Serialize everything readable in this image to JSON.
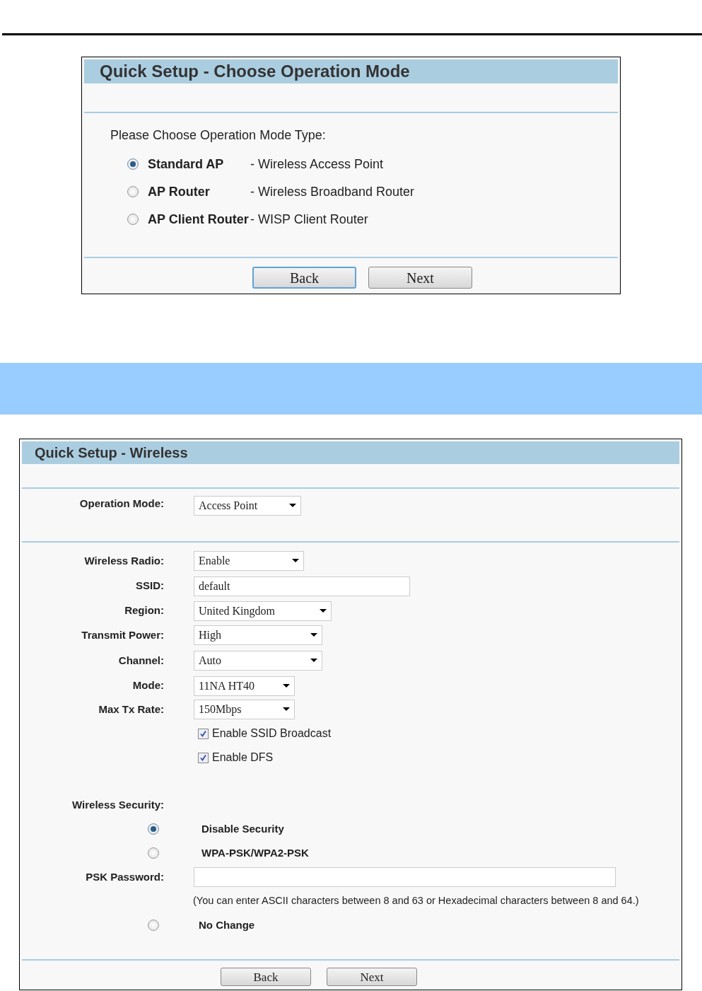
{
  "mode_panel": {
    "title": "Quick Setup - Choose Operation Mode",
    "prompt": "Please Choose Operation Mode Type:",
    "options": [
      {
        "name": "Standard AP",
        "description": "- Wireless Access Point",
        "selected": true
      },
      {
        "name": "AP Router",
        "description": "- Wireless Broadband Router",
        "selected": false
      },
      {
        "name": "AP Client Router",
        "description": "- WISP Client Router",
        "selected": false
      }
    ],
    "buttons": [
      {
        "label": "Back",
        "focused": true
      },
      {
        "label": "Next",
        "focused": false
      }
    ]
  },
  "wireless_panel": {
    "title": "Quick Setup - Wireless",
    "operation_mode": {
      "label": "Operation Mode:",
      "value": "Access Point"
    },
    "fields": [
      {
        "kind": "select",
        "label": "Wireless Radio:",
        "value": "Enable"
      },
      {
        "kind": "text",
        "label": "SSID:",
        "value": "default"
      },
      {
        "kind": "select",
        "label": "Region:",
        "value": "United Kingdom"
      },
      {
        "kind": "select",
        "label": "Transmit Power:",
        "value": "High"
      },
      {
        "kind": "select",
        "label": "Channel:",
        "value": "Auto"
      },
      {
        "kind": "select",
        "label": "Mode:",
        "value": "11NA HT40"
      },
      {
        "kind": "select",
        "label": "Max Tx Rate:",
        "value": "150Mbps"
      }
    ],
    "checkboxes": [
      {
        "label": "Enable SSID Broadcast",
        "checked": true
      },
      {
        "label": "Enable DFS",
        "checked": true
      }
    ],
    "security": {
      "label": "Wireless Security:",
      "items": [
        {
          "kind": "radio",
          "label": "Disable Security",
          "selected": true
        },
        {
          "kind": "radio",
          "label": "WPA-PSK/WPA2-PSK",
          "selected": false
        },
        {
          "kind": "password",
          "label": "PSK Password:",
          "value": ""
        },
        {
          "kind": "note",
          "text": "(You can enter ASCII characters between 8 and 63 or Hexadecimal characters between 8 and 64.)"
        },
        {
          "kind": "radio",
          "label": "No Change",
          "selected": false
        }
      ]
    },
    "buttons": [
      {
        "label": "Back",
        "focused": false
      },
      {
        "label": "Next",
        "focused": false
      }
    ]
  }
}
